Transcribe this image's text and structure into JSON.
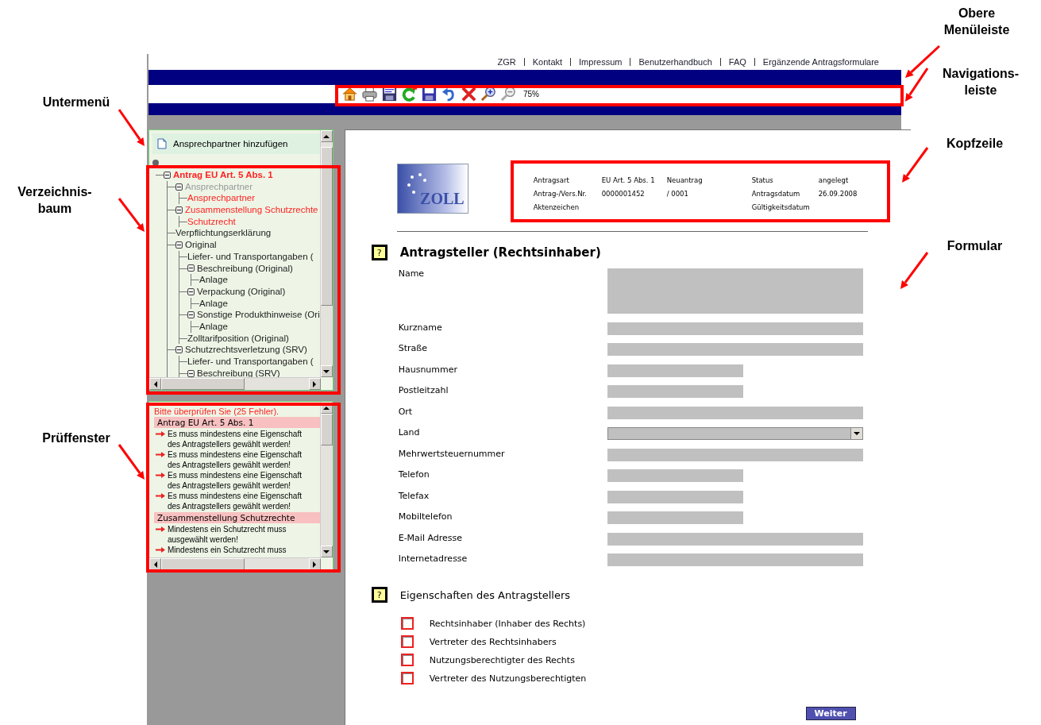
{
  "top_menu": [
    "ZGR",
    "Kontakt",
    "Impressum",
    "Benutzerhandbuch",
    "FAQ",
    "Ergänzende Antragsformulare"
  ],
  "toolbar": {
    "zoom": "75%"
  },
  "submenu": {
    "item": "Ansprechpartner hinzufügen"
  },
  "tree": [
    {
      "label": "Antrag EU Art. 5 Abs. 1",
      "error": true,
      "inactive": false,
      "expanded": true,
      "children": [
        {
          "label": "Ansprechpartner",
          "error": false,
          "inactive": true,
          "expanded": true,
          "children": [
            {
              "label": "Ansprechpartner",
              "error": true,
              "inactive": false
            }
          ]
        },
        {
          "label": "Zusammenstellung Schutzrechte",
          "error": true,
          "inactive": false,
          "expanded": true,
          "children": [
            {
              "label": "Schutzrecht",
              "error": true,
              "inactive": false
            }
          ]
        },
        {
          "label": "Verpflichtungserklärung",
          "error": false,
          "inactive": false
        },
        {
          "label": "Original",
          "error": false,
          "inactive": false,
          "expanded": true,
          "children": [
            {
              "label": "Liefer- und Transportangaben (",
              "error": false,
              "inactive": false
            },
            {
              "label": "Beschreibung (Original)",
              "error": false,
              "inactive": false,
              "expanded": true,
              "children": [
                {
                  "label": "Anlage",
                  "error": false,
                  "inactive": false
                }
              ]
            },
            {
              "label": "Verpackung (Original)",
              "error": false,
              "inactive": false,
              "expanded": true,
              "children": [
                {
                  "label": "Anlage",
                  "error": false,
                  "inactive": false
                }
              ]
            },
            {
              "label": "Sonstige Produkthinweise (Ori",
              "error": false,
              "inactive": false,
              "expanded": true,
              "children": [
                {
                  "label": "Anlage",
                  "error": false,
                  "inactive": false
                }
              ]
            },
            {
              "label": "Zolltarifposition (Original)",
              "error": false,
              "inactive": false
            }
          ]
        },
        {
          "label": "Schutzrechtsverletzung (SRV)",
          "error": false,
          "inactive": false,
          "expanded": true,
          "children": [
            {
              "label": "Liefer- und Transportangaben (",
              "error": false,
              "inactive": false
            },
            {
              "label": "Beschreibung (SRV)",
              "error": false,
              "inactive": false,
              "expanded": true
            }
          ]
        }
      ]
    }
  ],
  "check_window": {
    "title": "Bitte überprüfen Sie (25 Fehler).",
    "groups": [
      {
        "heading": "Antrag EU Art. 5 Abs. 1",
        "messages": [
          "Es muss mindestens eine Eigenschaft des Antragstellers gewählt werden!",
          "Es muss mindestens eine Eigenschaft des Antragstellers gewählt werden!",
          "Es muss mindestens eine Eigenschaft des Antragstellers gewählt werden!",
          "Es muss mindestens eine Eigenschaft des Antragstellers gewählt werden!"
        ]
      },
      {
        "heading": "Zusammenstellung Schutzrechte",
        "messages": [
          "Mindestens ein Schutzrecht muss ausgewählt werden!",
          "Mindestens ein Schutzrecht muss"
        ]
      }
    ]
  },
  "logo": {
    "text": "ZOLL"
  },
  "header": {
    "rows": [
      {
        "label": "Antragsart",
        "value": "EU Art. 5 Abs. 1",
        "extra": "Neuantrag",
        "label_2": "Status",
        "value_2": "angelegt"
      },
      {
        "label": "Antrag-/Vers.Nr.",
        "value": "0000001452",
        "extra": "/ 0001",
        "label_2": "Antragsdatum",
        "value_2": "26.09.2008"
      },
      {
        "label": "Aktenzeichen",
        "label_2": "Gültigkeitsdatum"
      }
    ]
  },
  "sections": [
    {
      "kind": "fields",
      "help": "?",
      "title": "Antragsteller (Rechtsinhaber)",
      "fields": [
        {
          "label": "Name",
          "kind": "multiline"
        },
        {
          "label": "Kurzname",
          "kind": "wide"
        },
        {
          "label": "Straße",
          "kind": "wide"
        },
        {
          "label": "Hausnummer",
          "kind": "short"
        },
        {
          "label": "Postleitzahl",
          "kind": "short"
        },
        {
          "label": "Ort",
          "kind": "wide"
        },
        {
          "label": "Land",
          "kind": "select"
        },
        {
          "label": "Mehrwertsteuernummer",
          "kind": "wide"
        },
        {
          "label": "Telefon",
          "kind": "short"
        },
        {
          "label": "Telefax",
          "kind": "short"
        },
        {
          "label": "Mobiltelefon",
          "kind": "short"
        },
        {
          "label": "E-Mail Adresse",
          "kind": "wide"
        },
        {
          "label": "Internetadresse",
          "kind": "wide"
        }
      ]
    },
    {
      "kind": "checkboxes",
      "help": "?",
      "title": "Eigenschaften des Antragstellers",
      "options": [
        {
          "label": "Rechtsinhaber (Inhaber des Rechts)",
          "checked": false
        },
        {
          "label": "Vertreter des Rechtsinhabers",
          "checked": false
        },
        {
          "label": "Nutzungsberechtigter des Rechts",
          "checked": false
        },
        {
          "label": "Vertreter des Nutzungsberechtigten",
          "checked": false
        }
      ]
    }
  ],
  "next_button": "Weiter",
  "annotations": [
    {
      "text": "Obere\nMenüleiste"
    },
    {
      "text": "Navigations-\nleiste"
    },
    {
      "text": "Untermenü"
    },
    {
      "text": "Kopfzeile"
    },
    {
      "text": "Verzeichnis-\nbaum"
    },
    {
      "text": "Formular"
    },
    {
      "text": "Prüffenster"
    }
  ]
}
